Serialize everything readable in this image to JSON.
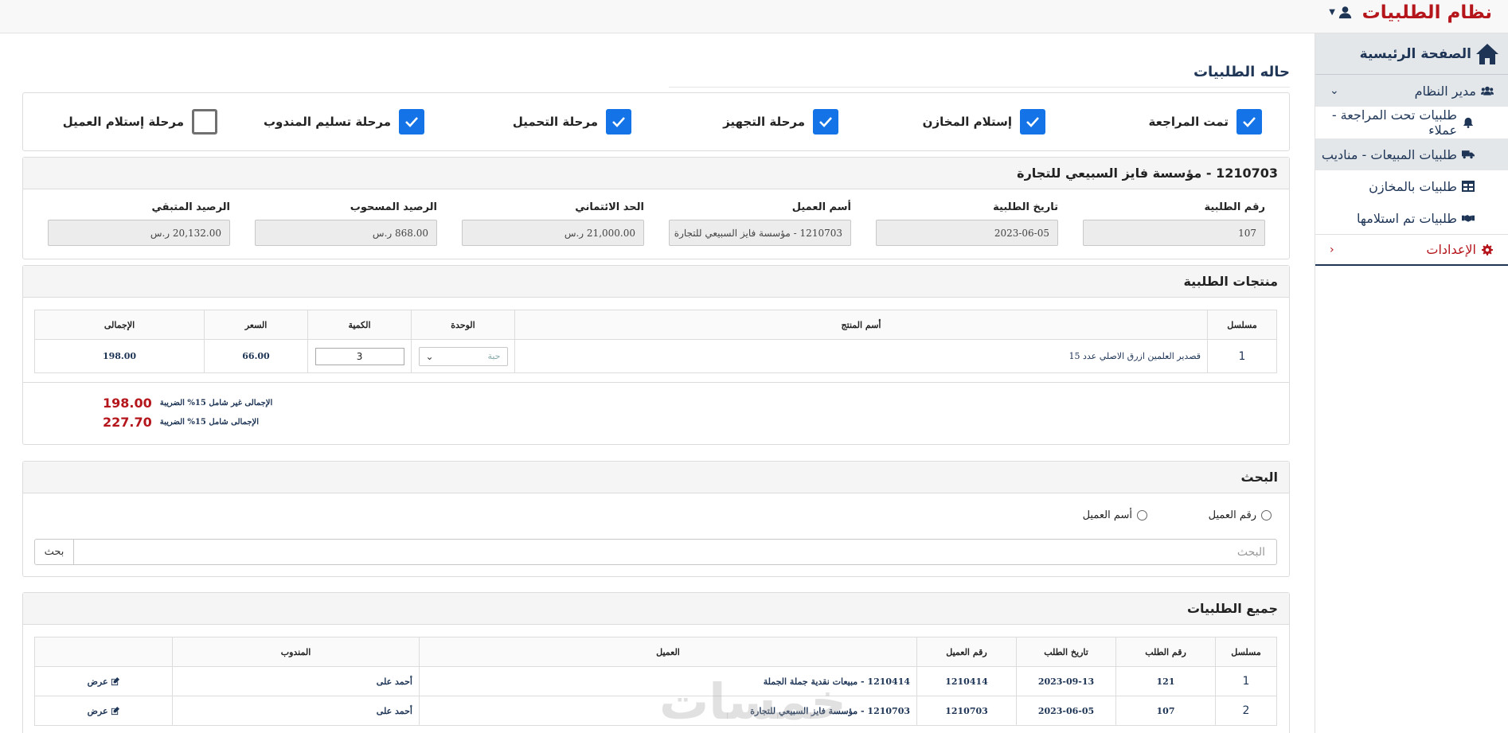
{
  "app": {
    "title": "نظام الطلبيات"
  },
  "sidebar": {
    "home": "الصفحة الرئيسية",
    "admin": "مدير النظام",
    "items": [
      {
        "label": "طلبيات تحت المراجعة - عملاء",
        "icon": "bell-icon"
      },
      {
        "label": "طلبيات المبيعات - مناديب",
        "icon": "truck-icon"
      },
      {
        "label": "طلبيات بالمخازن",
        "icon": "table-icon"
      },
      {
        "label": "طلبيات تم استلامها",
        "icon": "handshake-icon"
      }
    ],
    "settings": "الإعدادات"
  },
  "status": {
    "title": "حاله الطلبيات",
    "stages": [
      {
        "label": "تمت المراجعة",
        "checked": true
      },
      {
        "label": "إستلام المخازن",
        "checked": true
      },
      {
        "label": "مرحلة التجهيز",
        "checked": true
      },
      {
        "label": "مرحلة التحميل",
        "checked": true
      },
      {
        "label": "مرحلة تسليم المندوب",
        "checked": true
      },
      {
        "label": "مرحلة إستلام العميل",
        "checked": false
      }
    ]
  },
  "order": {
    "header": "1210703 - مؤسسة فايز السبيعي للتجارة",
    "fields": [
      {
        "label": "رقم الطلبية",
        "value": "107"
      },
      {
        "label": "تاريخ الطلبية",
        "value": "2023-06-05"
      },
      {
        "label": "أسم العميل",
        "value": "1210703 - مؤسسة فايز السبيعي للتجارة"
      },
      {
        "label": "الحد الائتماني",
        "value": "21,000.00 ر.س"
      },
      {
        "label": "الرصيد المسحوب",
        "value": "868.00 ر.س"
      },
      {
        "label": "الرصيد المتبقي",
        "value": "20,132.00 ر.س"
      }
    ]
  },
  "products": {
    "title": "منتجات الطلبية",
    "columns": [
      "مسلسل",
      "أسم المنتج",
      "الوحدة",
      "الكمية",
      "السعر",
      "الإجمالى"
    ],
    "rows": [
      {
        "serial": "1",
        "name": "قصدير العلمين ازرق الاصلي عدد 15",
        "unit": "حبة",
        "qty": "3",
        "price": "66.00",
        "total": "198.00"
      }
    ],
    "total_excl_label": "الإجمالى غير شامل 15% الضريبة",
    "total_excl_value": "198.00",
    "total_incl_label": "الإجمالى شامل 15% الضريبة",
    "total_incl_value": "227.70"
  },
  "search": {
    "title": "البحث",
    "radio_customer_no": "رقم العميل",
    "radio_customer_name": "أسم العميل",
    "placeholder": "البحث",
    "button": "بحث"
  },
  "orders": {
    "title": "جميع الطلبيات",
    "columns": [
      "مسلسل",
      "رقم الطلب",
      "تاريخ الطلب",
      "رقم العميل",
      "العميل",
      "المندوب",
      ""
    ],
    "rows": [
      {
        "serial": "1",
        "order_no": "121",
        "date": "2023-09-13",
        "customer_no": "1210414",
        "customer": "1210414 - مبيعات نقدية جملة الجملة",
        "rep": "أحمد على",
        "action": "عرض"
      },
      {
        "serial": "2",
        "order_no": "107",
        "date": "2023-06-05",
        "customer_no": "1210703",
        "customer": "1210703 - مؤسسة فايز السبيعي للتجارة",
        "rep": "أحمد على",
        "action": "عرض"
      }
    ]
  },
  "watermark": "خمسات",
  "colors": {
    "brand": "#b5161c",
    "navy": "#1e3556",
    "checkbox": "#1473e6"
  }
}
